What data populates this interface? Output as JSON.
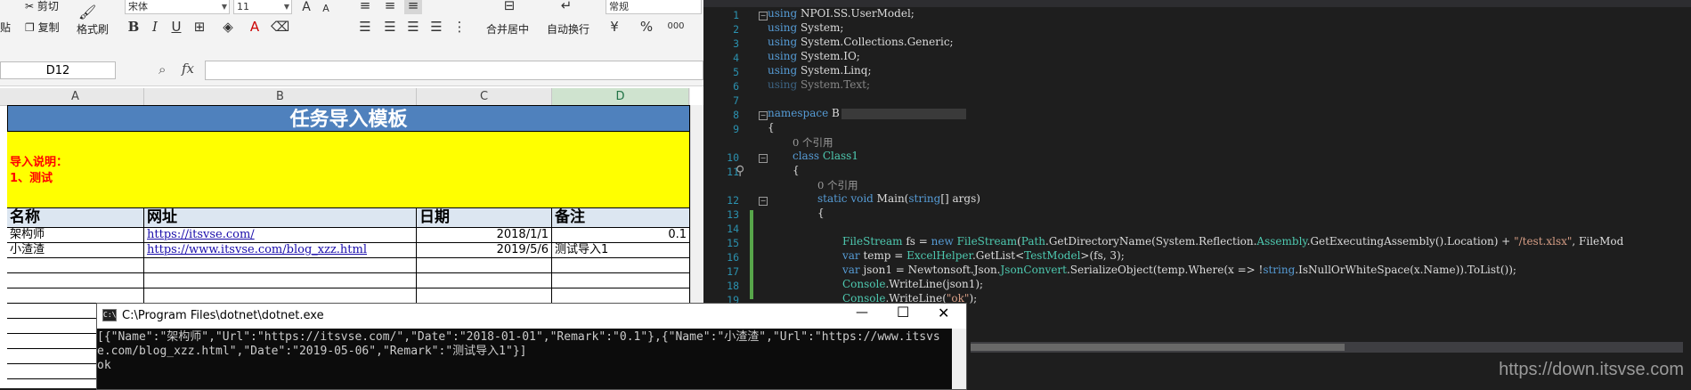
{
  "excel": {
    "ribbon": {
      "cut": "剪切",
      "copy": "复制",
      "format_painter": "格式刷",
      "paste_short": "贴",
      "font_name": "宋体",
      "font_size": "11",
      "merge_center": "合并居中",
      "wrap_text": "自动换行",
      "number_format": "常规",
      "bold": "B",
      "italic": "I",
      "underline": "U",
      "grow_font": "A",
      "shrink_font": "A",
      "percent": "%",
      "thousands": "000"
    },
    "name_box": "D12",
    "fx": "fx",
    "columns": [
      "A",
      "B",
      "C",
      "D"
    ],
    "title": "任务导入模板",
    "instructions": [
      "导入说明：",
      "1、测试"
    ],
    "headers": [
      "名称",
      "网址",
      "日期",
      "备注"
    ],
    "rows": [
      {
        "name": "架构师",
        "url": "https://itsvse.com/",
        "date": "2018/1/1",
        "remark": "0.1"
      },
      {
        "name": "小渣渣",
        "url": "https://www.itsvse.com/blog_xzz.html",
        "date": "2019/5/6",
        "remark": "测试导入1"
      }
    ]
  },
  "code": {
    "line_numbers": [
      "1",
      "2",
      "3",
      "4",
      "5",
      "6",
      "7",
      "8",
      "9",
      "10",
      "11",
      "12",
      "13",
      "14",
      "15",
      "16",
      "17",
      "18",
      "19"
    ],
    "ref_comment": "0 个引用",
    "lines": {
      "l1_kw": "using",
      "l1_rest": " NPOI.SS.UserModel;",
      "l2_kw": "using",
      "l2_rest": " System;",
      "l3_kw": "using",
      "l3_rest": " System.Collections.Generic;",
      "l4_kw": "using",
      "l4_rest": " System.IO;",
      "l5_kw": "using",
      "l5_rest": " System.Linq;",
      "l6_kw": "using",
      "l6_rest": " System.Text;",
      "l8_kw": "namespace",
      "l8_rest": " B",
      "l9": "{",
      "l10_kw": "class",
      "l10_type": " Class1",
      "l11": "{",
      "l12_kw": "static void",
      "l12_rest1": " Main(",
      "l12_kw2": "string",
      "l12_rest2": "[] args)",
      "l13": "{",
      "l15_type": "FileStream",
      "l15_a": " fs = ",
      "l15_kw": "new",
      "l15_type2": " FileStream",
      "l15_b": "(",
      "l15_type3": "Path",
      "l15_c": ".GetDirectoryName(System.Reflection.",
      "l15_type4": "Assembly",
      "l15_d": ".GetExecutingAssembly().Location) + ",
      "l15_str": "\"/test.xlsx\"",
      "l15_e": ", FileMod",
      "l16_kw": "var",
      "l16_a": " temp = ",
      "l16_type": "ExcelHelper",
      "l16_b": ".GetList<",
      "l16_type2": "TestModel",
      "l16_c": ">(fs, 3);",
      "l17_kw": "var",
      "l17_a": " json1 = Newtonsoft.Json.",
      "l17_type": "JsonConvert",
      "l17_b": ".SerializeObject(temp.Where(x => !",
      "l17_kw2": "string",
      "l17_c": ".IsNullOrWhiteSpace(x.Name)).ToList());",
      "l18_type": "Console",
      "l18_rest": ".WriteLine(json1);",
      "l19_type": "Console",
      "l19_rest": ".WriteLine(",
      "l19_str": "\"ok\"",
      "l19_end": ");"
    }
  },
  "console": {
    "title": "C:\\Program Files\\dotnet\\dotnet.exe",
    "output": "[{\"Name\":\"架构师\",\"Url\":\"https://itsvse.com/\",\"Date\":\"2018-01-01\",\"Remark\":\"0.1\"},{\"Name\":\"小渣渣\",\"Url\":\"https://www.itsvse.com/blog_xzz.html\",\"Date\":\"2019-05-06\",\"Remark\":\"测试导入1\"}]\nok",
    "minimize": "—",
    "maximize": "☐",
    "close": "✕"
  },
  "watermark": "https://down.itsvse.com",
  "colors": {
    "title_bar": "#4f81bd",
    "instruction_bg": "#ffff00",
    "instruction_text": "#ff0000",
    "header_bg": "#dce6f1"
  }
}
